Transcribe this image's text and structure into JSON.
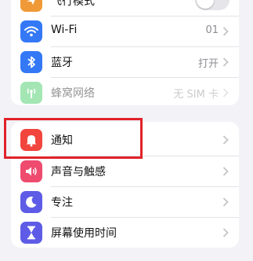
{
  "connectivity": {
    "airplane": {
      "label": "飞行模式",
      "icon": "airplane-icon",
      "color": "#f09a37",
      "toggle_on": false
    },
    "wifi": {
      "label": "Wi-Fi",
      "value": "01",
      "icon": "wifi-icon",
      "color": "#3478f6"
    },
    "bluetooth": {
      "label": "蓝牙",
      "value": "打开",
      "icon": "bluetooth-icon",
      "color": "#3478f6"
    },
    "cellular": {
      "label": "蜂窝网络",
      "value": "无 SIM 卡",
      "icon": "antenna-icon",
      "color": "#34c759"
    }
  },
  "attention": {
    "notifications": {
      "label": "通知",
      "icon": "bell-icon",
      "color": "#f1453d"
    },
    "sounds": {
      "label": "声音与触感",
      "icon": "speaker-icon",
      "color": "#ee4b6f"
    },
    "focus": {
      "label": "专注",
      "icon": "moon-icon",
      "color": "#5e5ce6"
    },
    "screen_time": {
      "label": "屏幕使用时间",
      "icon": "hourglass-icon",
      "color": "#5e5ce6"
    }
  },
  "highlight_color": "#e0222a"
}
